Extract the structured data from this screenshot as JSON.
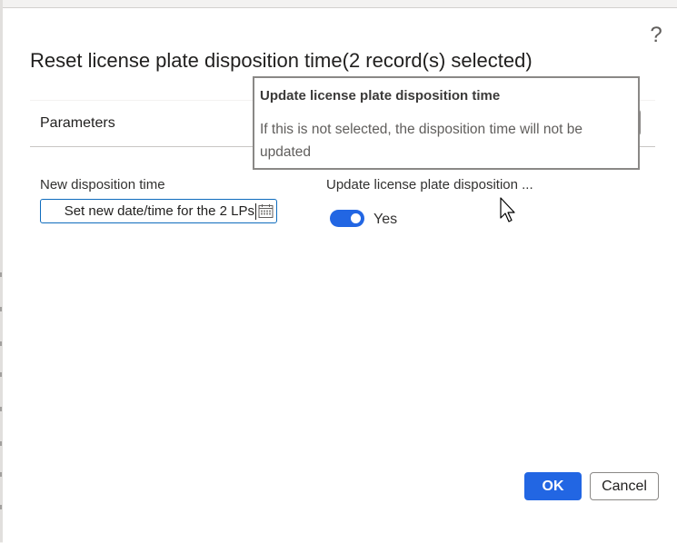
{
  "dialog": {
    "title": "Reset license plate disposition time(2 record(s) selected)",
    "help_glyph": "?"
  },
  "section": {
    "title": "Parameters"
  },
  "fields": {
    "disposition_time": {
      "label": "New disposition time",
      "value": "Set new date/time for the 2 LPs"
    },
    "update_toggle": {
      "label": "Update license plate disposition ...",
      "state_label": "Yes",
      "on": true
    }
  },
  "tooltip": {
    "title": "Update license plate disposition time",
    "body": "If this is not selected, the disposition time will not be updated"
  },
  "buttons": {
    "ok": "OK",
    "cancel": "Cancel"
  },
  "colors": {
    "accent": "#2266e3",
    "focus_border": "#0f6cbd"
  },
  "icons": {
    "help": "help-icon",
    "calendar": "calendar-icon",
    "cursor": "mouse-pointer-icon"
  }
}
